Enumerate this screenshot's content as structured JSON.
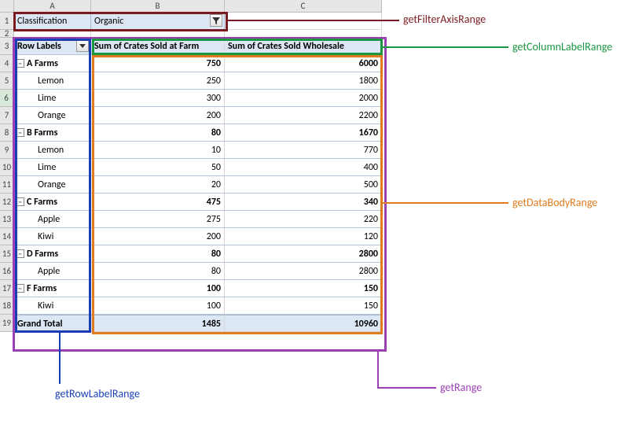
{
  "columns": {
    "A": "A",
    "B": "B",
    "C": "C"
  },
  "rowNumbers": [
    "1",
    "2",
    "3",
    "4",
    "5",
    "6",
    "7",
    "8",
    "9",
    "10",
    "11",
    "12",
    "13",
    "14",
    "15",
    "16",
    "17",
    "18",
    "19"
  ],
  "filter": {
    "label": "Classification",
    "value": "Organic"
  },
  "pivot": {
    "rowLabelsHeader": "Row Labels",
    "col1Header": "Sum of Crates Sold at Farm",
    "col2Header": "Sum of Crates Sold Wholesale",
    "rows": [
      {
        "type": "farm",
        "label": "A Farms",
        "v1": "750",
        "v2": "6000"
      },
      {
        "type": "item",
        "label": "Lemon",
        "v1": "250",
        "v2": "1800"
      },
      {
        "type": "item",
        "label": "Lime",
        "v1": "300",
        "v2": "2000"
      },
      {
        "type": "item",
        "label": "Orange",
        "v1": "200",
        "v2": "2200"
      },
      {
        "type": "farm",
        "label": "B Farms",
        "v1": "80",
        "v2": "1670"
      },
      {
        "type": "item",
        "label": "Lemon",
        "v1": "10",
        "v2": "770"
      },
      {
        "type": "item",
        "label": "Lime",
        "v1": "50",
        "v2": "400"
      },
      {
        "type": "item",
        "label": "Orange",
        "v1": "20",
        "v2": "500"
      },
      {
        "type": "farm",
        "label": "C Farms",
        "v1": "475",
        "v2": "340"
      },
      {
        "type": "item",
        "label": "Apple",
        "v1": "275",
        "v2": "220"
      },
      {
        "type": "item",
        "label": "Kiwi",
        "v1": "200",
        "v2": "120"
      },
      {
        "type": "farm",
        "label": "D Farms",
        "v1": "80",
        "v2": "2800"
      },
      {
        "type": "item",
        "label": "Apple",
        "v1": "80",
        "v2": "2800"
      },
      {
        "type": "farm",
        "label": "F Farms",
        "v1": "100",
        "v2": "150"
      },
      {
        "type": "item",
        "label": "Kiwi",
        "v1": "100",
        "v2": "150"
      }
    ],
    "grandTotal": {
      "label": "Grand Total",
      "v1": "1485",
      "v2": "10960"
    }
  },
  "annotations": {
    "filterAxisRange": "getFilterAxisRange",
    "columnLabelRange": "getColumnLabelRange",
    "dataBodyRange": "getDataBodyRange",
    "range": "getRange",
    "rowLabelRange": "getRowLabelRange"
  },
  "colors": {
    "maroon": "#7b1a23",
    "green": "#1a9641",
    "blue": "#1a3fb5",
    "orange": "#e07b1f",
    "purple": "#9b3fb5"
  }
}
